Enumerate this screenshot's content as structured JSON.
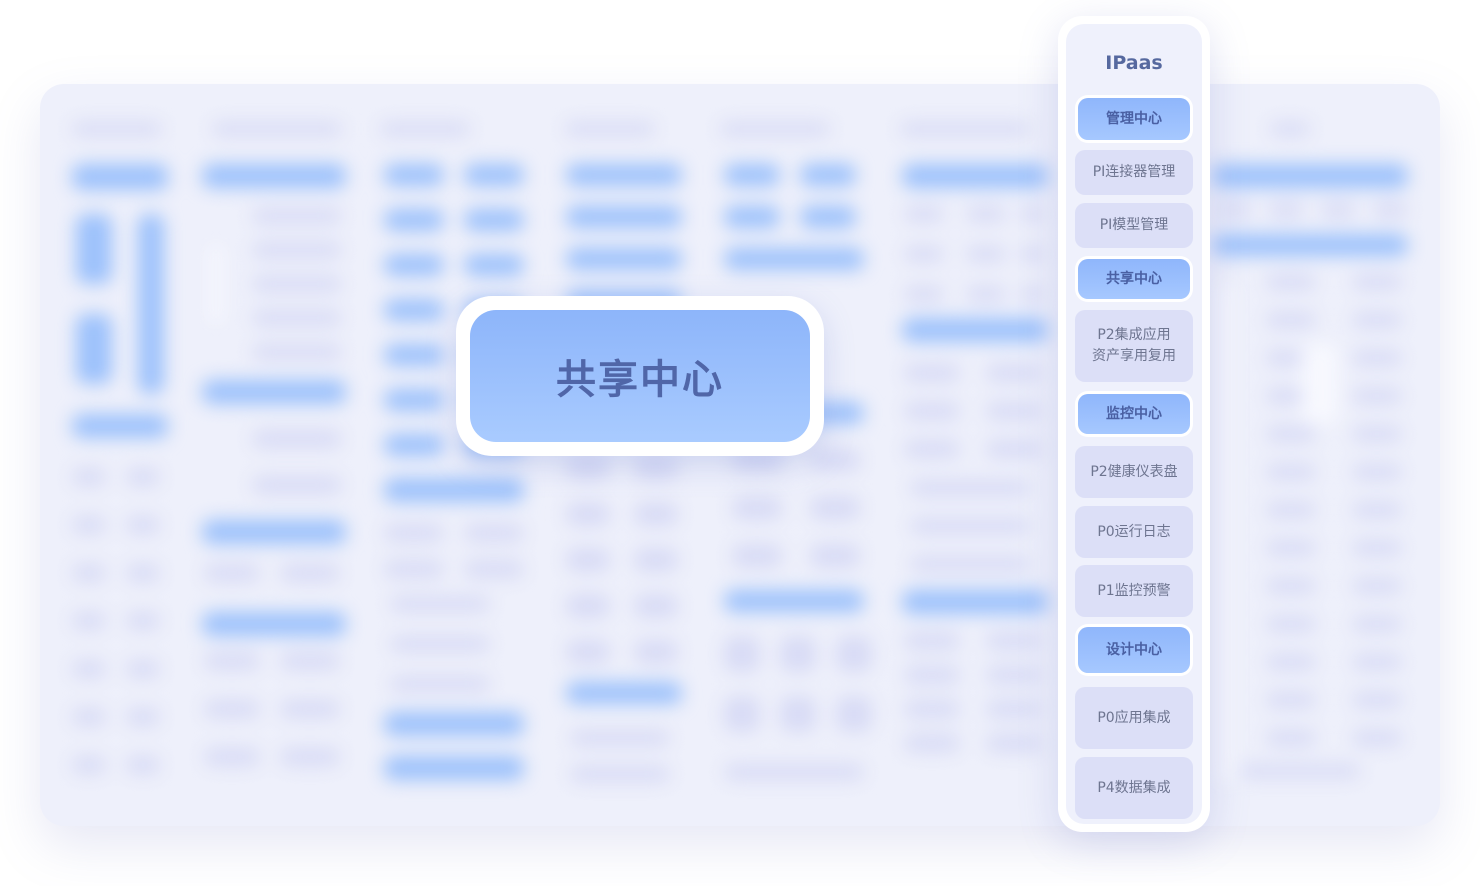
{
  "center_callout": {
    "label": "共享中心"
  },
  "panel": {
    "title": "IPaas",
    "items": [
      {
        "label": "管理中心",
        "kind": "section"
      },
      {
        "label": "PI连接器管理",
        "kind": "item"
      },
      {
        "label": "PI模型管理",
        "kind": "item"
      },
      {
        "label": "共享中心",
        "kind": "section"
      },
      {
        "label": "P2集成应用\n资产享用复用",
        "kind": "item"
      },
      {
        "label": "监控中心",
        "kind": "section"
      },
      {
        "label": "P2健康仪表盘",
        "kind": "item"
      },
      {
        "label": "P0运行日志",
        "kind": "item"
      },
      {
        "label": "P1监控预警",
        "kind": "item"
      },
      {
        "label": "设计中心",
        "kind": "section"
      },
      {
        "label": "P0应用集成",
        "kind": "item"
      },
      {
        "label": "P4数据集成",
        "kind": "item"
      }
    ]
  },
  "colors": {
    "section_blue": "#8fb6fb",
    "item_lavender": "#dcdff7",
    "text_primary": "#56699f"
  }
}
